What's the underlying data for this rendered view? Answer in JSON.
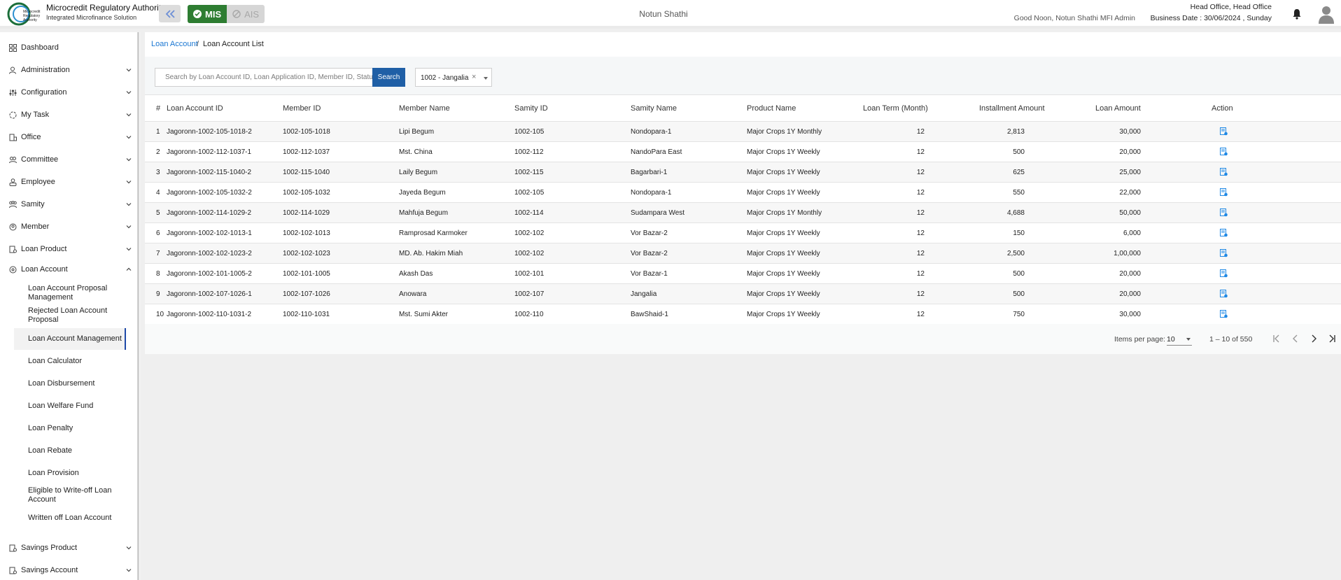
{
  "header": {
    "org_name": "Microcredit Regulatory Authority",
    "org_subtitle": "Integrated Microfinance Solution",
    "logo_text": [
      "Microcredit",
      "Regulatory",
      "Authority"
    ],
    "mode_active": "MIS",
    "mode_inactive": "AIS",
    "center_title": "Notun Shathi",
    "greeting": "Good Noon, Notun Shathi MFI Admin",
    "office": "Head Office, Head Office",
    "business_date": "Business Date : 30/06/2024 , Sunday",
    "accent_green": "#2e7d32",
    "accent_blue": "#1f5fa6"
  },
  "sidebar": {
    "items": [
      {
        "label": "Dashboard",
        "icon": "dashboard-icon"
      },
      {
        "label": "Administration",
        "icon": "admin-icon"
      },
      {
        "label": "Configuration",
        "icon": "sliders-icon"
      },
      {
        "label": "My Task",
        "icon": "task-icon"
      },
      {
        "label": "Office",
        "icon": "office-icon"
      },
      {
        "label": "Committee",
        "icon": "committee-icon"
      },
      {
        "label": "Employee",
        "icon": "employee-icon"
      },
      {
        "label": "Samity",
        "icon": "samity-icon"
      },
      {
        "label": "Member",
        "icon": "member-icon"
      },
      {
        "label": "Loan Product",
        "icon": "loan-product-icon"
      },
      {
        "label": "Loan Account",
        "icon": "loan-account-icon"
      },
      {
        "label": "Savings Product",
        "icon": "savings-product-icon"
      },
      {
        "label": "Savings Account",
        "icon": "savings-account-icon"
      }
    ],
    "loan_account_sub": [
      "Loan Account Proposal Management",
      "Rejected Loan Account Proposal",
      "Loan Account Management",
      "Loan Calculator",
      "Loan Disbursement",
      "Loan Welfare Fund",
      "Loan Penalty",
      "Loan Rebate",
      "Loan Provision",
      "Eligible to Write-off Loan Account",
      "Written off Loan Account"
    ]
  },
  "breadcrumb": {
    "parent": "Loan Account",
    "separator": "/",
    "current": "Loan Account List"
  },
  "filters": {
    "search_placeholder": "Search by Loan Account ID, Loan Application ID, Member ID, Status...",
    "search_button": "Search",
    "branch_value": "1002 - Jangalia",
    "branch_clear": "×"
  },
  "table": {
    "headers": [
      "#",
      "Loan Account ID",
      "Member ID",
      "Member Name",
      "Samity ID",
      "Samity Name",
      "Product Name",
      "Loan Term (Month)",
      "Installment Amount",
      "Loan Amount",
      "Action"
    ],
    "rows": [
      {
        "n": "1",
        "loan_account_id": "Jagoronn-1002-105-1018-2",
        "member_id": "1002-105-1018",
        "member_name": "Lipi Begum",
        "samity_id": "1002-105",
        "samity_name": "Nondopara-1",
        "product": "Major Crops 1Y Monthly",
        "term": "12",
        "installment": "2,813",
        "amount": "30,000"
      },
      {
        "n": "2",
        "loan_account_id": "Jagoronn-1002-112-1037-1",
        "member_id": "1002-112-1037",
        "member_name": "Mst. China",
        "samity_id": "1002-112",
        "samity_name": "NandoPara East",
        "product": "Major Crops 1Y Weekly",
        "term": "12",
        "installment": "500",
        "amount": "20,000"
      },
      {
        "n": "3",
        "loan_account_id": "Jagoronn-1002-115-1040-2",
        "member_id": "1002-115-1040",
        "member_name": "Laily Begum",
        "samity_id": "1002-115",
        "samity_name": "Bagarbari-1",
        "product": "Major Crops 1Y Weekly",
        "term": "12",
        "installment": "625",
        "amount": "25,000"
      },
      {
        "n": "4",
        "loan_account_id": "Jagoronn-1002-105-1032-2",
        "member_id": "1002-105-1032",
        "member_name": "Jayeda Begum",
        "samity_id": "1002-105",
        "samity_name": "Nondopara-1",
        "product": "Major Crops 1Y Weekly",
        "term": "12",
        "installment": "550",
        "amount": "22,000"
      },
      {
        "n": "5",
        "loan_account_id": "Jagoronn-1002-114-1029-2",
        "member_id": "1002-114-1029",
        "member_name": "Mahfuja Begum",
        "samity_id": "1002-114",
        "samity_name": "Sudampara West",
        "product": "Major Crops 1Y Monthly",
        "term": "12",
        "installment": "4,688",
        "amount": "50,000"
      },
      {
        "n": "6",
        "loan_account_id": "Jagoronn-1002-102-1013-1",
        "member_id": "1002-102-1013",
        "member_name": "Ramprosad Karmoker",
        "samity_id": "1002-102",
        "samity_name": "Vor Bazar-2",
        "product": "Major Crops 1Y Weekly",
        "term": "12",
        "installment": "150",
        "amount": "6,000"
      },
      {
        "n": "7",
        "loan_account_id": "Jagoronn-1002-102-1023-2",
        "member_id": "1002-102-1023",
        "member_name": "MD. Ab. Hakim Miah",
        "samity_id": "1002-102",
        "samity_name": "Vor Bazar-2",
        "product": "Major Crops 1Y Weekly",
        "term": "12",
        "installment": "2,500",
        "amount": "1,00,000"
      },
      {
        "n": "8",
        "loan_account_id": "Jagoronn-1002-101-1005-2",
        "member_id": "1002-101-1005",
        "member_name": "Akash Das",
        "samity_id": "1002-101",
        "samity_name": "Vor Bazar-1",
        "product": "Major Crops 1Y Weekly",
        "term": "12",
        "installment": "500",
        "amount": "20,000"
      },
      {
        "n": "9",
        "loan_account_id": "Jagoronn-1002-107-1026-1",
        "member_id": "1002-107-1026",
        "member_name": "Anowara",
        "samity_id": "1002-107",
        "samity_name": "Jangalia",
        "product": "Major Crops 1Y Weekly",
        "term": "12",
        "installment": "500",
        "amount": "20,000"
      },
      {
        "n": "10",
        "loan_account_id": "Jagoronn-1002-110-1031-2",
        "member_id": "1002-110-1031",
        "member_name": "Mst. Sumi Akter",
        "samity_id": "1002-110",
        "samity_name": "BawShaid-1",
        "product": "Major Crops 1Y Weekly",
        "term": "12",
        "installment": "750",
        "amount": "30,000"
      }
    ]
  },
  "paginator": {
    "items_per_page_label": "Items per page:",
    "items_per_page": "10",
    "range": "1 – 10 of 550"
  }
}
